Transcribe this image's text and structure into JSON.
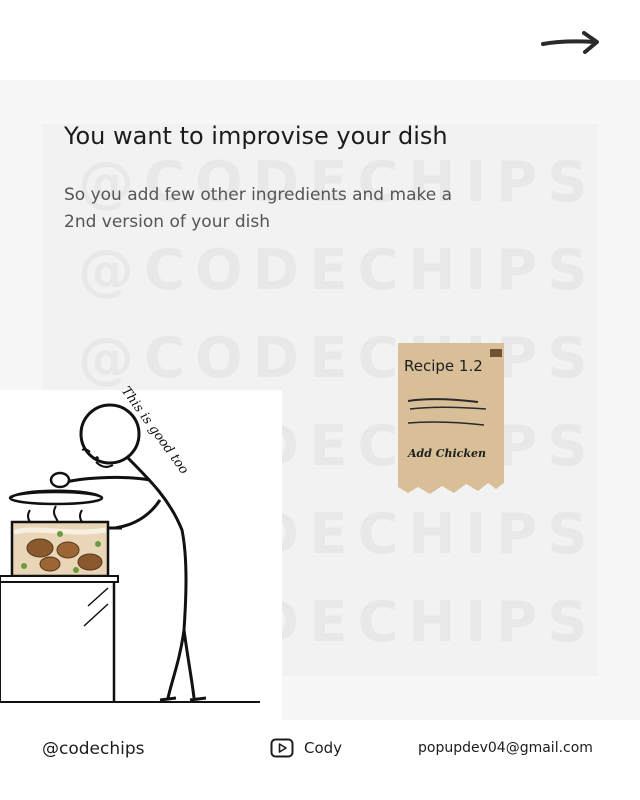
{
  "header": {
    "next_icon": "arrow-right-icon"
  },
  "slide": {
    "title": "You want to improvise your dish",
    "subtitle": "So you add few other ingredients and make a 2nd version of your dish",
    "watermark_text": "@CODECHIPS",
    "speech_text": "This is good too"
  },
  "recipe_card": {
    "title": "Recipe 1.2",
    "note": "Add Chicken"
  },
  "footer": {
    "handle": "@codechips",
    "youtube_icon": "play-icon",
    "youtube_name": "Cody",
    "email": "popupdev04@gmail.com"
  },
  "colors": {
    "background": "#ffffff",
    "panel": "#f7f7f7",
    "recipe_paper": "#d8bf98",
    "ink": "#1c1c1c"
  }
}
